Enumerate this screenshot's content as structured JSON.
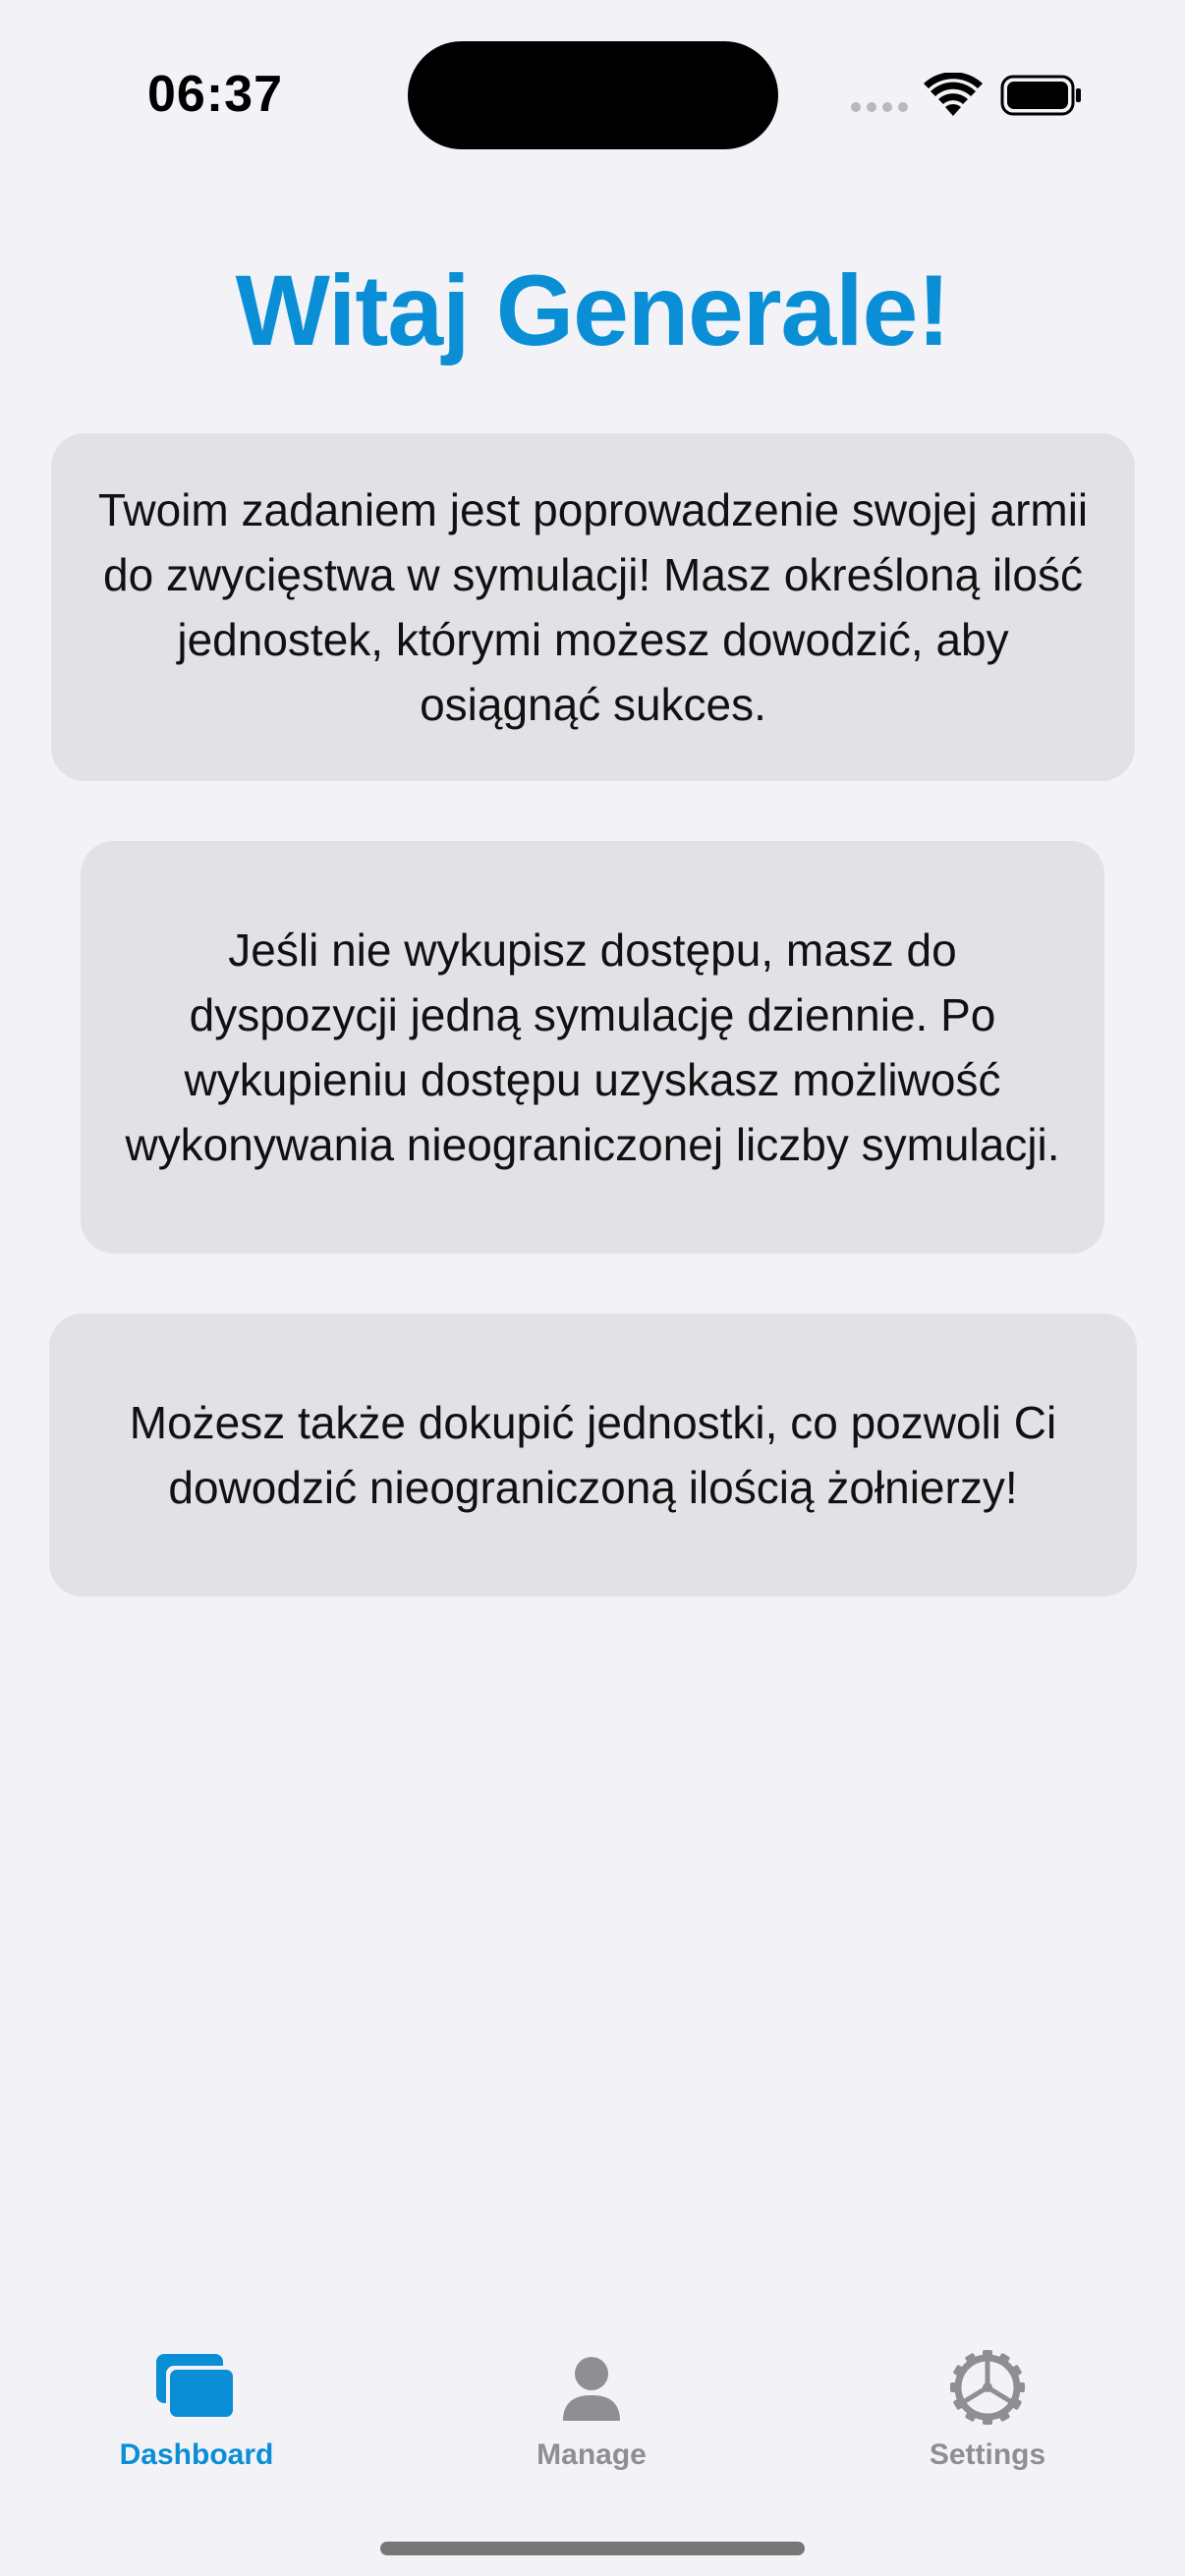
{
  "status_bar": {
    "time": "06:37"
  },
  "title": "Witaj Generale!",
  "cards": [
    {
      "text": "Twoim zadaniem jest poprowadzenie swojej armii do zwycięstwa w symulacji! Masz określoną ilość jednostek, którymi możesz dowodzić, aby osiągnąć sukces."
    },
    {
      "text": "Jeśli nie wykupisz dostępu, masz do dyspozycji jedną symulację dziennie. Po wykupieniu dostępu uzyskasz możliwość wykonywania nieograniczonej liczby symulacji."
    },
    {
      "text": "Możesz także dokupić jednostki, co pozwoli Ci dowodzić nieograniczoną ilością żołnierzy!"
    }
  ],
  "tab_bar": {
    "tabs": [
      {
        "label": "Dashboard",
        "icon": "dashboard-icon",
        "selected": true
      },
      {
        "label": "Manage",
        "icon": "person-icon",
        "selected": false
      },
      {
        "label": "Settings",
        "icon": "gear-icon",
        "selected": false
      }
    ]
  },
  "colors": {
    "accent": "#0a8fd6",
    "background": "#f2f2f7",
    "card": "#e1e1e6",
    "tab_inactive": "#8e8e93"
  }
}
